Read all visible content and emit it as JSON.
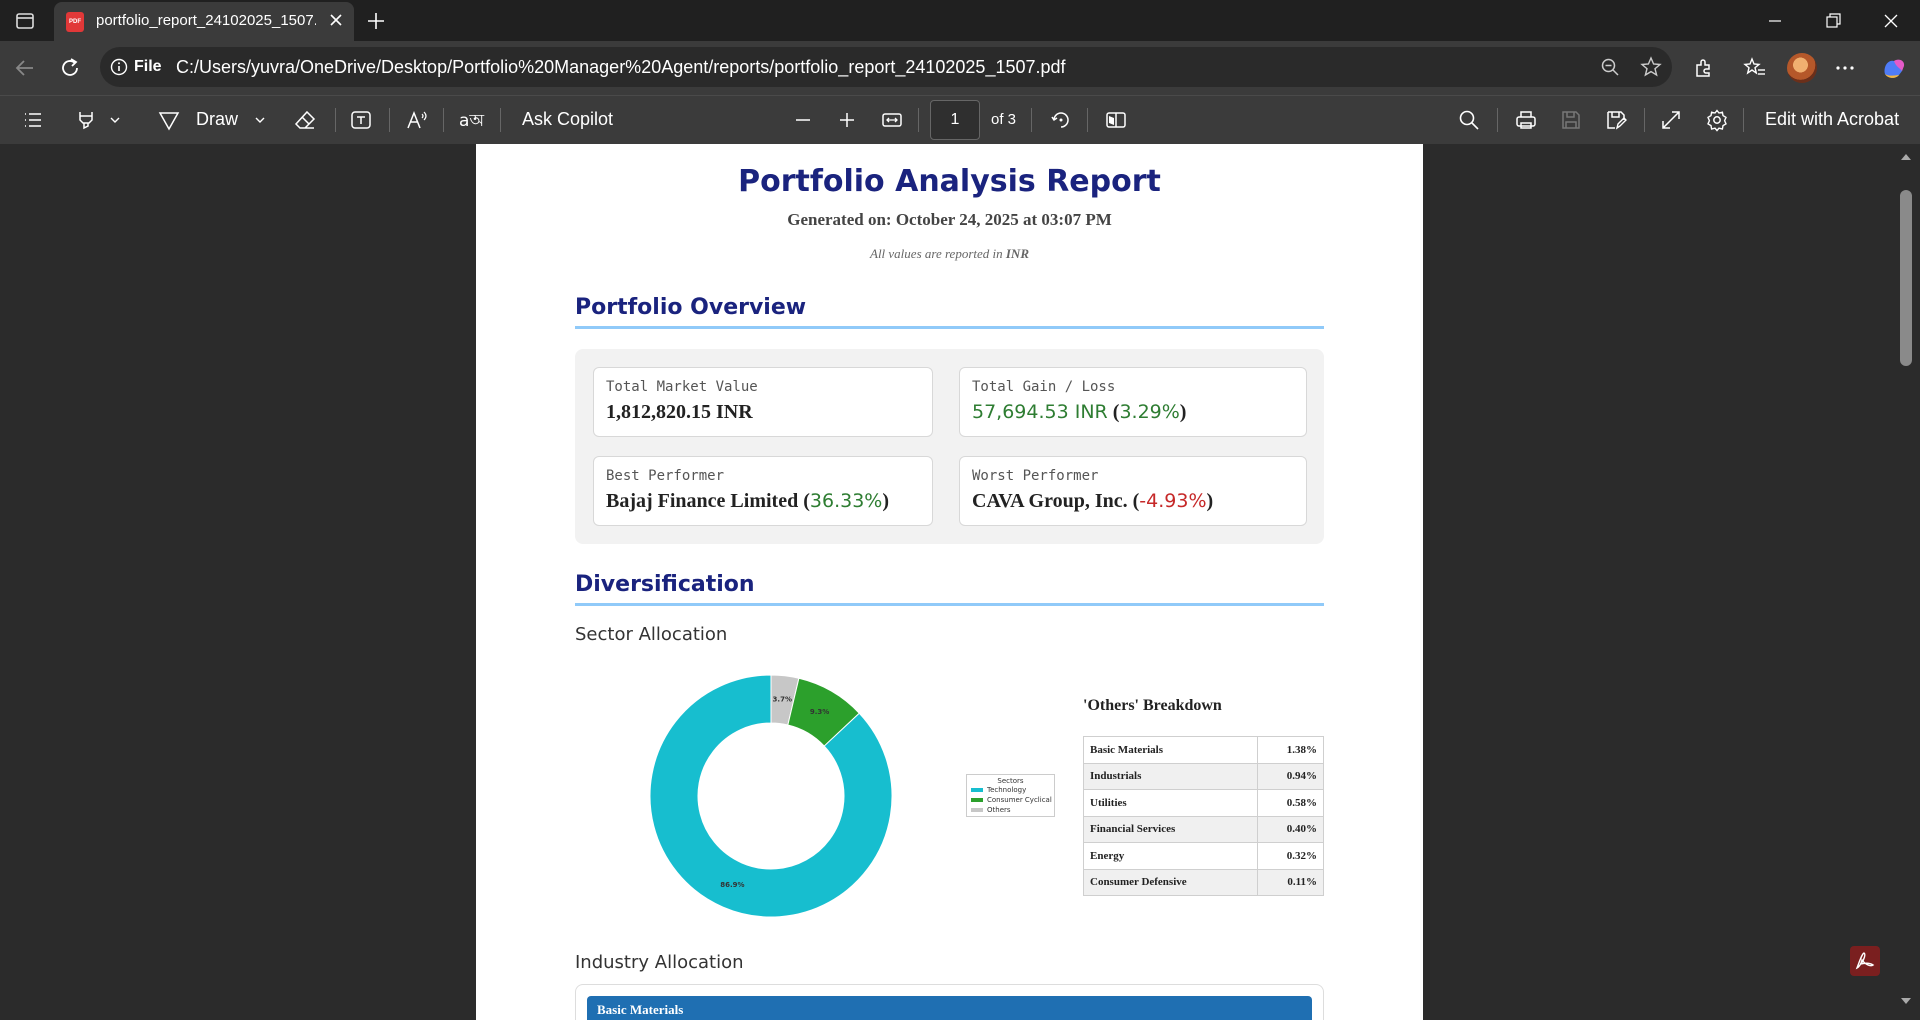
{
  "browser": {
    "tab_title": "portfolio_report_24102025_1507.pdf",
    "tab_badge": "PDF",
    "address_scheme": "File",
    "url": "C:/Users/yuvra/OneDrive/Desktop/Portfolio%20Manager%20Agent/reports/portfolio_report_24102025_1507.pdf"
  },
  "pdf_toolbar": {
    "draw_label": "Draw",
    "ask_copilot_label": "Ask Copilot",
    "page_current": "1",
    "page_total_label": "of 3",
    "edit_acrobat_label": "Edit with Acrobat"
  },
  "report": {
    "title": "Portfolio Analysis Report",
    "generated": "Generated on: October 24, 2025 at 03:07 PM",
    "note_prefix": "All values are reported in ",
    "note_currency": "INR",
    "overview_heading": "Portfolio Overview",
    "cards": {
      "market_value_label": "Total Market Value",
      "market_value": "1,812,820.15 INR",
      "gain_label": "Total Gain / Loss",
      "gain_value": "57,694.53 INR",
      "gain_open": "(",
      "gain_pct": "3.29%",
      "gain_close": ")",
      "best_label": "Best Performer",
      "best_name": "Bajaj Finance Limited ",
      "best_open": "(",
      "best_pct": "36.33%",
      "best_close": ")",
      "worst_label": "Worst Performer",
      "worst_name": "CAVA Group, Inc. ",
      "worst_open": "(",
      "worst_pct": "-4.93%",
      "worst_close": ")"
    },
    "diversification_heading": "Diversification",
    "sector_heading": "Sector Allocation",
    "others_title": "'Others' Breakdown",
    "others_rows": [
      {
        "sector": "Basic Materials",
        "pct": "1.38%"
      },
      {
        "sector": "Industrials",
        "pct": "0.94%"
      },
      {
        "sector": "Utilities",
        "pct": "0.58%"
      },
      {
        "sector": "Financial Services",
        "pct": "0.40%"
      },
      {
        "sector": "Energy",
        "pct": "0.32%"
      },
      {
        "sector": "Consumer Defensive",
        "pct": "0.11%"
      }
    ],
    "industry_heading": "Industry Allocation",
    "industry_first": "Basic Materials"
  },
  "chart_data": {
    "type": "pie",
    "subtype": "donut",
    "legend_title": "Sectors",
    "legend_position": "right",
    "categories": [
      "Technology",
      "Consumer Cyclical",
      "Others"
    ],
    "values": [
      86.9,
      9.3,
      3.7
    ],
    "labels": [
      "86.9%",
      "9.3%",
      "3.7%"
    ],
    "colors": [
      "#17becf",
      "#2ca02c",
      "#c7c7c7"
    ]
  },
  "colors": {
    "title_navy": "#1a237e",
    "positive": "#2e7d32",
    "negative": "#c62828",
    "section_rule": "#90caf9"
  }
}
